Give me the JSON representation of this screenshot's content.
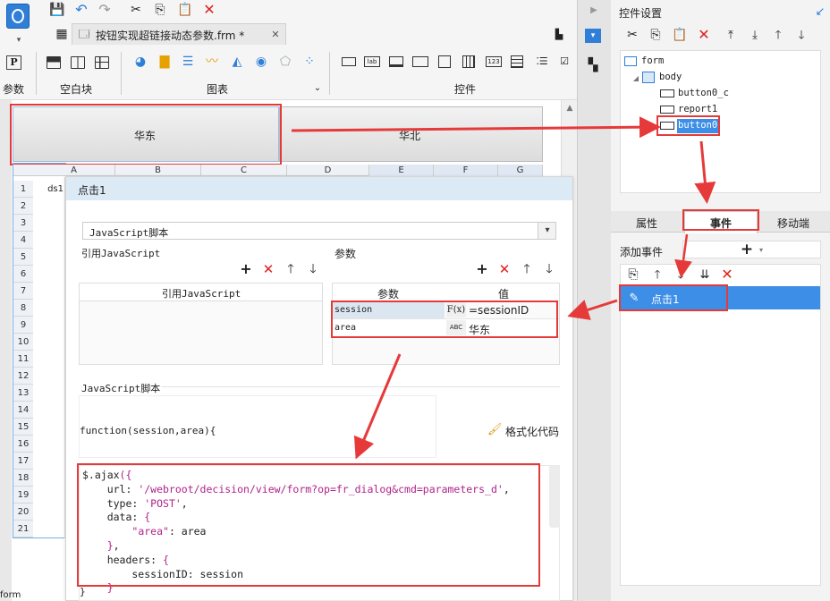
{
  "toolbar": {
    "tab_label": "按钮实现超链接动态参数.frm *",
    "sections": {
      "params": "参数",
      "blank": "空白块",
      "chart": "图表",
      "widget": "控件"
    }
  },
  "canvas": {
    "btn_east": "华东",
    "btn_north": "华北",
    "columns": [
      "A",
      "B",
      "C",
      "D",
      "E",
      "F",
      "G"
    ],
    "rows": [
      "1",
      "2",
      "3",
      "4",
      "5",
      "6",
      "7",
      "8",
      "9",
      "10",
      "11",
      "12",
      "13",
      "14",
      "15",
      "16",
      "17",
      "18",
      "19",
      "20",
      "21"
    ],
    "cell_a1": "ds1",
    "status_form": "form"
  },
  "dialog": {
    "title": "点击1",
    "type_select": "JavaScript脚本",
    "ref_js_label": "引用JavaScript",
    "ref_js_header": "引用JavaScript",
    "params_label": "参数",
    "param_col": "参数",
    "value_col": "值",
    "params": [
      {
        "name": "session",
        "type_icon": "F(x)",
        "value": "=sessionID"
      },
      {
        "name": "area",
        "type_icon": "ABC",
        "value": "华东"
      }
    ],
    "script_label": "JavaScript脚本",
    "func_sig": "function(session,area){",
    "format_btn": "格式化代码",
    "code_lines": [
      "$.ajax({",
      "    url: '/webroot/decision/view/form?op=fr_dialog&cmd=parameters_d',",
      "    type: 'POST',",
      "    data: {",
      "        \"area\": area",
      "    },",
      "    headers: {",
      "        sessionID: session",
      "    }"
    ],
    "close_brace": "}"
  },
  "right": {
    "title": "控件设置",
    "tree": [
      {
        "label": "form"
      },
      {
        "label": "body"
      },
      {
        "label": "button0_c"
      },
      {
        "label": "report1"
      },
      {
        "label": "button0"
      }
    ],
    "tabs": {
      "props": "属性",
      "events": "事件",
      "mobile": "移动端"
    },
    "add_event": "添加事件",
    "event_item": "点击1"
  },
  "colors": {
    "accent": "#1e88e5",
    "selection": "#3d8ee6",
    "red": "#e63a3a"
  }
}
